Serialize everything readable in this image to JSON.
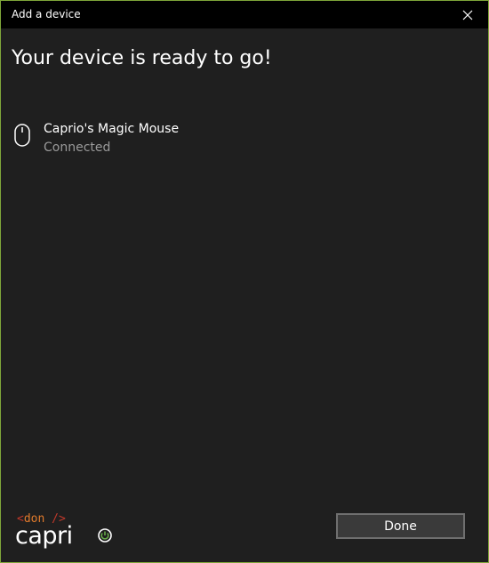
{
  "window": {
    "title": "Add a device",
    "close_icon": "close-icon"
  },
  "main": {
    "heading": "Your device is ready to go!",
    "device": {
      "icon": "mouse-icon",
      "name": "Caprio's Magic Mouse",
      "status": "Connected"
    }
  },
  "footer": {
    "logo": {
      "top_open": "<",
      "top_text": "don",
      "top_close": "/>",
      "main_text": "capri",
      "power_icon": "power-icon",
      "accent_color": "#6ab04c"
    },
    "done_label": "Done"
  },
  "colors": {
    "titlebar": "#000000",
    "background": "#1f1f1f",
    "window_border": "#7fa63a",
    "secondary_text": "#9a9a9a"
  }
}
